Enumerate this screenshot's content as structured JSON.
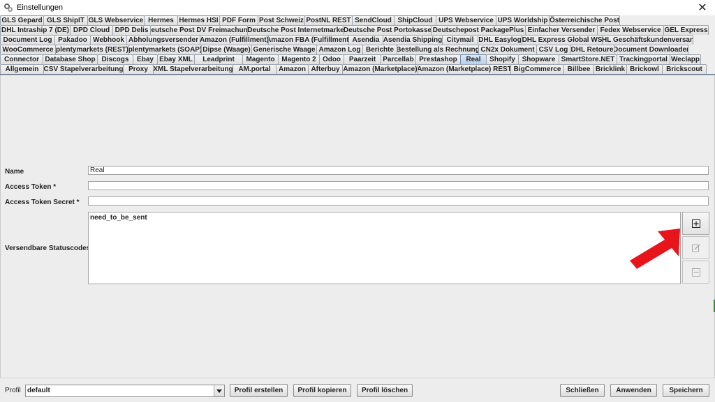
{
  "window": {
    "title": "Einstellungen",
    "close": "✕"
  },
  "tabs": {
    "row1": [
      "GLS Gepard",
      "GLS ShipIT",
      "GLS Webservice",
      "Hermes",
      "Hermes HSI",
      "PDF Form",
      "Post Schweiz",
      "PostNL REST",
      "SendCloud",
      "ShipCloud",
      "UPS Webservice",
      "UPS Worldship",
      "Österreichische Post"
    ],
    "row2": [
      "DHL Intraship 7 (DE)",
      "DPD Cloud",
      "DPD Delis",
      "Deutsche Post DV Freimachung",
      "Deutsche Post Internetmarke",
      "Deutsche Post Portokasse",
      "Deutschepost PackagePlus",
      "Einfacher Versender",
      "Fedex Webservice",
      "GEL Express"
    ],
    "row3": [
      "Document Log",
      "Pakadoo",
      "Webhook",
      "Abholungsversender",
      "Amazon (Fulfillment)",
      "Amazon FBA (Fulfillment)",
      "Asendia",
      "Asendia Shipping",
      "Citymail",
      "DHL Easylog",
      "DHL Express Global WS",
      "DHL Geschäftskundenversand"
    ],
    "row4": [
      "WooCommerce",
      "plentymarkets (REST)",
      "plentymarkets (SOAP)",
      "Dipse (Waage)",
      "Generische Waage",
      "Amazon Log",
      "Berichte",
      "Bestellung als Rechnung",
      "CN2x Dokument",
      "CSV Log",
      "DHL Retoure",
      "Document Downloader"
    ],
    "row5": [
      "Connector",
      "Database Shop",
      "Discogs",
      "Ebay",
      "Ebay XML",
      "Leadprint",
      "Magento",
      "Magento 2",
      "Odoo",
      "Paarzeit",
      "Parcellab",
      "Prestashop",
      "Real",
      "Shopify",
      "Shopware",
      "SmartStore.NET",
      "Trackingportal",
      "Weclapp"
    ],
    "row6": [
      "Allgemein",
      "CSV Stapelverarbeitung",
      "Proxy",
      "XML Stapelverarbeitung",
      "AM.portal",
      "Amazon",
      "Afterbuy",
      "Amazon (Marketplace)",
      "Amazon (Marketplace) REST",
      "BigCommerce",
      "Billbee",
      "Bricklink",
      "Brickowl",
      "Brickscout"
    ],
    "selected": "Real"
  },
  "form": {
    "name_label": "Name",
    "name_value": "Real",
    "token_label": "Access Token *",
    "token_value": "",
    "secret_label": "Access Token Secret *",
    "secret_value": "",
    "status_label": "Versendbare Statuscodes *",
    "status_items": [
      "need_to_be_sent"
    ]
  },
  "icons": {
    "add": "plus-square-icon",
    "edit": "edit-icon",
    "remove": "minus-square-icon",
    "dropdown": "chevron-down-icon"
  },
  "colors": {
    "arrow": "#e8141b",
    "selected_tab": "#b8d0ea"
  },
  "bottom": {
    "profile_label": "Profil",
    "profile_value": "default",
    "create": "Profil erstellen",
    "copy": "Profil kopieren",
    "delete": "Profil löschen",
    "close": "Schließen",
    "apply": "Anwenden",
    "save": "Speichern"
  }
}
